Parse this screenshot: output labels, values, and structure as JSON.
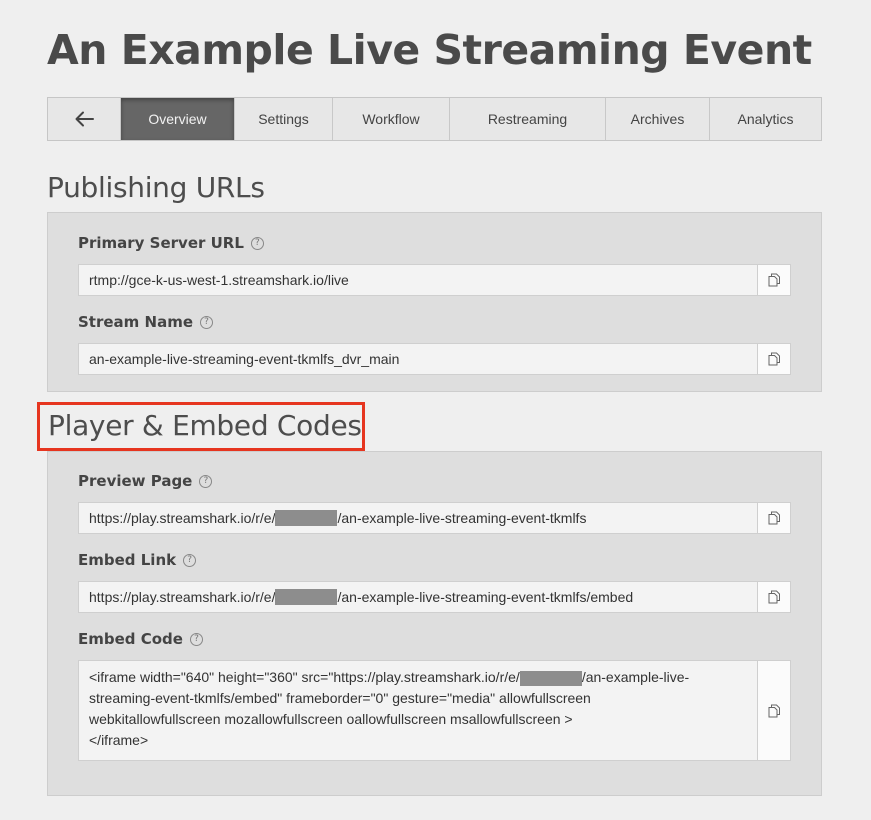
{
  "page": {
    "title": "An Example Live Streaming Event"
  },
  "tabs": [
    {
      "label": "Overview",
      "active": true
    },
    {
      "label": "Settings"
    },
    {
      "label": "Workflow"
    },
    {
      "label": "Restreaming"
    },
    {
      "label": "Archives"
    },
    {
      "label": "Analytics"
    }
  ],
  "icons": {
    "back": "arrow-left-icon",
    "help": "question-circle-icon",
    "copy": "copy-document-icon"
  },
  "colors": {
    "active_tab": "#666666",
    "highlight": "#e6351f",
    "panel": "#dedede"
  },
  "publishing": {
    "heading": "Publishing URLs",
    "primary_server_label": "Primary Server URL",
    "primary_server_url": "rtmp://gce-k-us-west-1.streamshark.io/live",
    "stream_name_label": "Stream Name",
    "stream_name": "an-example-live-streaming-event-tkmlfs_dvr_main"
  },
  "player": {
    "heading": "Player & Embed Codes",
    "preview_label": "Preview Page",
    "preview_prefix": "https://play.streamshark.io/r/e/",
    "preview_suffix": "/an-example-live-streaming-event-tkmlfs",
    "embed_link_label": "Embed Link",
    "embed_link_prefix": "https://play.streamshark.io/r/e/",
    "embed_link_suffix": "/an-example-live-streaming-event-tkmlfs/embed",
    "embed_code_label": "Embed Code",
    "embed_code_prefix": "<iframe width=\"640\" height=\"360\" src=\"https://play.streamshark.io/r/e/",
    "embed_code_suffix": "/an-example-live-\nstreaming-event-tkmlfs/embed\" frameborder=\"0\" gesture=\"media\" allowfullscreen\nwebkitallowfullscreen mozallowfullscreen oallowfullscreen msallowfullscreen >\n</iframe>"
  },
  "help_glyph": "?"
}
